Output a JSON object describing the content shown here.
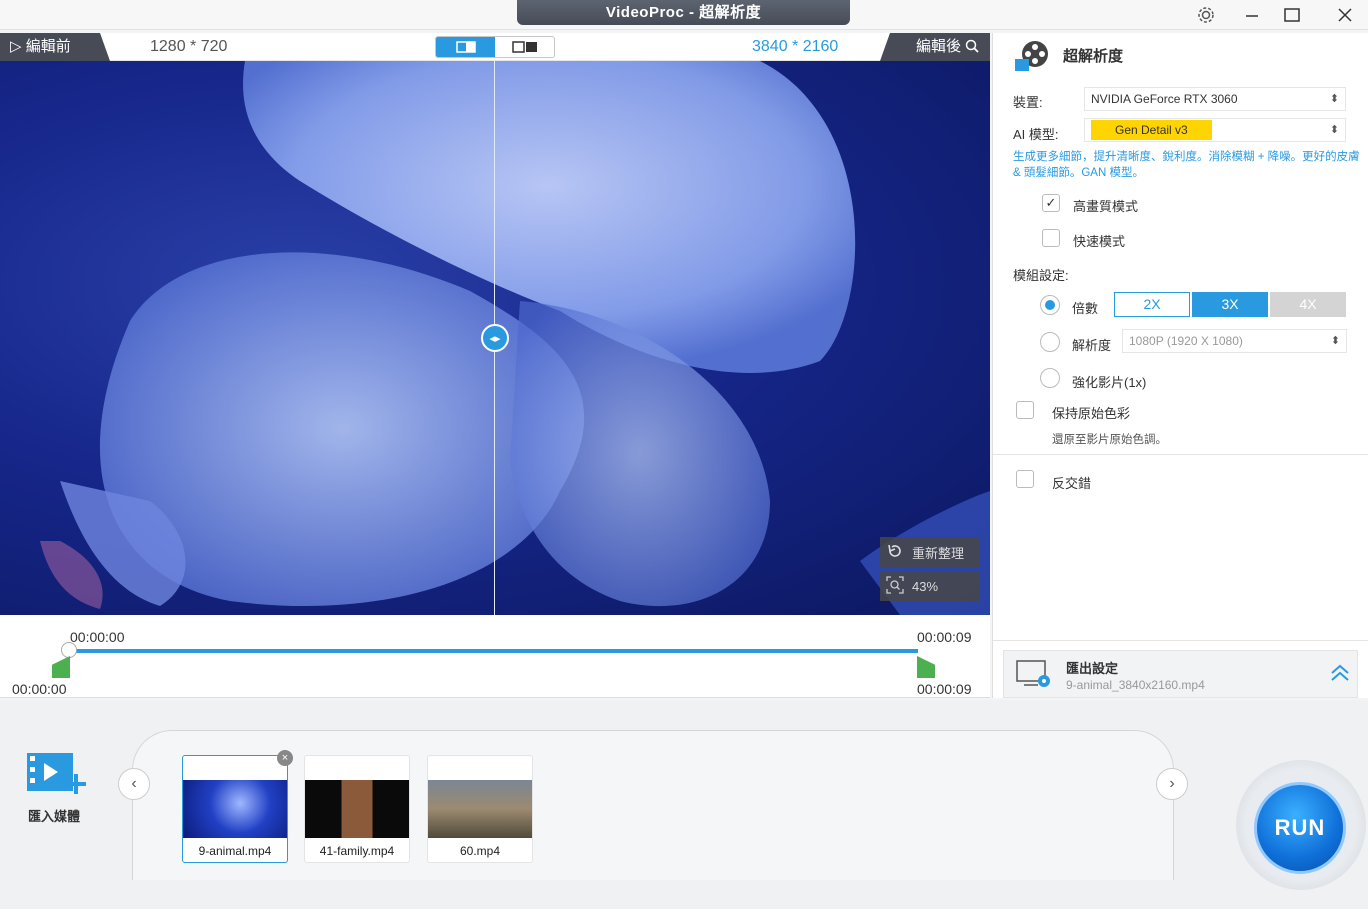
{
  "window": {
    "title": "VideoProc - 超解析度"
  },
  "preview": {
    "before_label": "編輯前",
    "after_label": "編輯後",
    "source_resolution": "1280 * 720",
    "output_resolution": "3840 * 2160",
    "reset_label": "重新整理",
    "zoom_label": "43%"
  },
  "timeline": {
    "start_top": "00:00:00",
    "end_top": "00:00:09",
    "start_bottom": "00:00:00",
    "end_bottom": "00:00:09",
    "progress_fraction": 1.0
  },
  "panel": {
    "title": "超解析度",
    "device_label": "裝置:",
    "device_value": "NVIDIA GeForce RTX 3060",
    "model_label": "AI 模型:",
    "model_value": "Gen Detail v3",
    "model_color": "#ffd400",
    "description": "生成更多細節，提升清晰度、銳利度。消除模糊 + 降噪。更好的皮膚 & 頭髮細節。GAN 模型。",
    "high_quality_label": "高畫質模式",
    "high_quality_checked": true,
    "fast_mode_label": "快速模式",
    "fast_mode_checked": false,
    "module_label": "模組設定:",
    "scale_label": "倍數",
    "scale_options": [
      "2X",
      "3X",
      "4X"
    ],
    "scale_selected": "3X",
    "resolution_label": "解析度",
    "resolution_value": "1080P (1920 X 1080)",
    "enhance_label": "強化影片(1x)",
    "keep_color_label": "保持原始色彩",
    "keep_color_desc": "還原至影片原始色調。",
    "deinterlace_label": "反交錯",
    "accent_color": "#2a9ae0"
  },
  "export": {
    "label": "匯出設定",
    "filename": "9-animal_3840x2160.mp4"
  },
  "media": {
    "import_label": "匯入媒體",
    "files": [
      {
        "name": "9-animal.mp4",
        "active": true
      },
      {
        "name": "41-family.mp4",
        "active": false
      },
      {
        "name": "60.mp4",
        "active": false
      }
    ]
  },
  "run_label": "RUN"
}
